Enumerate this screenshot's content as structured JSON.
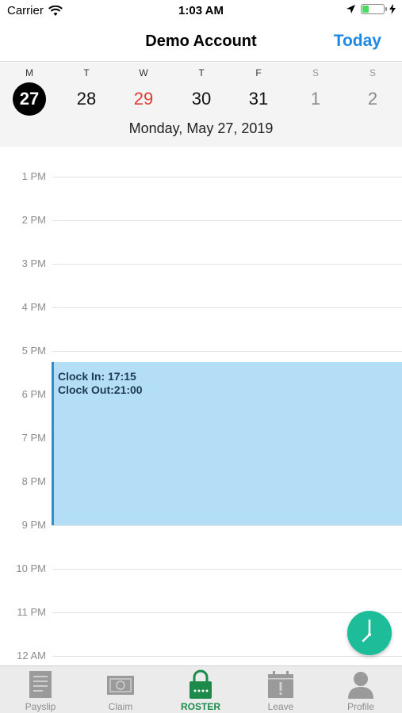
{
  "status_bar": {
    "carrier": "Carrier",
    "time": "1:03 AM",
    "battery_level": 0.3
  },
  "nav": {
    "title": "Demo Account",
    "today_button": "Today"
  },
  "week": {
    "days": [
      {
        "letter": "M",
        "number": "27",
        "state": "selected"
      },
      {
        "letter": "T",
        "number": "28",
        "state": "normal"
      },
      {
        "letter": "W",
        "number": "29",
        "state": "today"
      },
      {
        "letter": "T",
        "number": "30",
        "state": "normal"
      },
      {
        "letter": "F",
        "number": "31",
        "state": "normal"
      },
      {
        "letter": "S",
        "number": "1",
        "state": "weekend"
      },
      {
        "letter": "S",
        "number": "2",
        "state": "weekend"
      }
    ],
    "selected_date": "Monday, May 27, 2019"
  },
  "timeline": {
    "hours": [
      "1 PM",
      "2 PM",
      "3 PM",
      "4 PM",
      "5 PM",
      "6 PM",
      "7 PM",
      "8 PM",
      "9 PM",
      "10 PM",
      "11 PM",
      "12 AM"
    ],
    "event": {
      "clock_in": "Clock In: 17:15",
      "clock_out": "Clock Out:21:00"
    }
  },
  "fab": {
    "icon": "clock-icon"
  },
  "tab_bar": {
    "tabs": [
      {
        "label": "Payslip",
        "icon": "payslip-icon"
      },
      {
        "label": "Claim",
        "icon": "claim-icon"
      },
      {
        "label": "ROSTER",
        "icon": "roster-icon",
        "active": true
      },
      {
        "label": "Leave",
        "icon": "leave-icon"
      },
      {
        "label": "Profile",
        "icon": "profile-icon"
      }
    ]
  },
  "colors": {
    "accent": "#1e88e5",
    "today_red": "#e53935",
    "event_fill": "#b3def5",
    "event_border": "#2f8fce",
    "fab": "#1dbd9a",
    "tab_active": "#1c8a4a"
  }
}
